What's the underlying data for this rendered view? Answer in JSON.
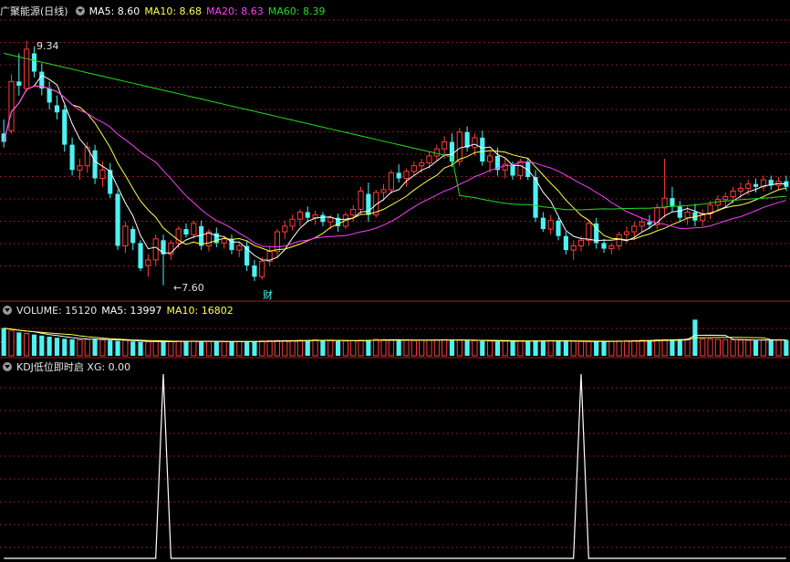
{
  "header": {
    "title": "广聚能源(日线)",
    "ma": [
      {
        "label": "MA5: 8.60",
        "color": "#ffffff"
      },
      {
        "label": "MA10: 8.68",
        "color": "#ffff4a"
      },
      {
        "label": "MA20: 8.63",
        "color": "#ff3dff"
      },
      {
        "label": "MA60: 8.39",
        "color": "#22dd22"
      }
    ]
  },
  "volume_header": {
    "label": "VOLUME: 15120",
    "ma": [
      {
        "label": "MA5: 13997",
        "color": "#ffffff"
      },
      {
        "label": "MA10: 16802",
        "color": "#ffff4a"
      }
    ]
  },
  "kdj_header": {
    "label": "KDJ低位即时启 XG: 0.00"
  },
  "annotations": {
    "high_label": "9.34",
    "low_label": "←7.60",
    "event_marker": "财"
  },
  "colors": {
    "up": "#ff3c3c",
    "down": "#4ef2f2",
    "ma5": "#ffffff",
    "ma10": "#ffff4a",
    "ma20": "#ff3dff",
    "ma60": "#22dd22",
    "grid": "#8b1a1a",
    "frame": "#a01e1e",
    "xg": "#ffffff"
  },
  "chart_data": [
    {
      "type": "candlestick",
      "title": "广聚能源(日线)",
      "ylim": [
        7.5,
        9.5
      ],
      "grid": true,
      "bars": [
        {
          "o": 8.68,
          "h": 8.78,
          "l": 8.58,
          "c": 8.62
        },
        {
          "o": 8.7,
          "h": 9.1,
          "l": 8.68,
          "c": 9.05
        },
        {
          "o": 9.05,
          "h": 9.25,
          "l": 8.95,
          "c": 9.02
        },
        {
          "o": 9.0,
          "h": 9.34,
          "l": 8.98,
          "c": 9.28
        },
        {
          "o": 9.25,
          "h": 9.3,
          "l": 9.08,
          "c": 9.12
        },
        {
          "o": 9.12,
          "h": 9.18,
          "l": 8.95,
          "c": 9.0
        },
        {
          "o": 9.0,
          "h": 9.05,
          "l": 8.85,
          "c": 8.9
        },
        {
          "o": 8.88,
          "h": 8.95,
          "l": 8.78,
          "c": 8.83
        },
        {
          "o": 8.85,
          "h": 8.88,
          "l": 8.55,
          "c": 8.6
        },
        {
          "o": 8.6,
          "h": 8.65,
          "l": 8.38,
          "c": 8.42
        },
        {
          "o": 8.42,
          "h": 8.5,
          "l": 8.35,
          "c": 8.45
        },
        {
          "o": 8.45,
          "h": 8.62,
          "l": 8.4,
          "c": 8.58
        },
        {
          "o": 8.56,
          "h": 8.6,
          "l": 8.32,
          "c": 8.36
        },
        {
          "o": 8.36,
          "h": 8.48,
          "l": 8.3,
          "c": 8.42
        },
        {
          "o": 8.42,
          "h": 8.47,
          "l": 8.22,
          "c": 8.25
        },
        {
          "o": 8.25,
          "h": 8.28,
          "l": 7.85,
          "c": 7.88
        },
        {
          "o": 7.88,
          "h": 8.05,
          "l": 7.83,
          "c": 8.02
        },
        {
          "o": 8.0,
          "h": 8.02,
          "l": 7.85,
          "c": 7.9
        },
        {
          "o": 7.9,
          "h": 7.92,
          "l": 7.7,
          "c": 7.72
        },
        {
          "o": 7.74,
          "h": 7.82,
          "l": 7.66,
          "c": 7.78
        },
        {
          "o": 7.78,
          "h": 7.96,
          "l": 7.74,
          "c": 7.93
        },
        {
          "o": 7.92,
          "h": 7.96,
          "l": 7.6,
          "c": 7.82
        },
        {
          "o": 7.82,
          "h": 7.92,
          "l": 7.78,
          "c": 7.9
        },
        {
          "o": 7.9,
          "h": 8.02,
          "l": 7.86,
          "c": 8.0
        },
        {
          "o": 8.0,
          "h": 8.04,
          "l": 7.94,
          "c": 7.96
        },
        {
          "o": 7.96,
          "h": 8.06,
          "l": 7.93,
          "c": 8.04
        },
        {
          "o": 8.02,
          "h": 8.06,
          "l": 7.85,
          "c": 7.88
        },
        {
          "o": 7.88,
          "h": 8.0,
          "l": 7.84,
          "c": 7.98
        },
        {
          "o": 7.97,
          "h": 8.01,
          "l": 7.87,
          "c": 7.9
        },
        {
          "o": 7.9,
          "h": 7.95,
          "l": 7.86,
          "c": 7.93
        },
        {
          "o": 7.93,
          "h": 7.96,
          "l": 7.82,
          "c": 7.85
        },
        {
          "o": 7.85,
          "h": 7.9,
          "l": 7.8,
          "c": 7.88
        },
        {
          "o": 7.88,
          "h": 7.92,
          "l": 7.7,
          "c": 7.74
        },
        {
          "o": 7.74,
          "h": 7.78,
          "l": 7.63,
          "c": 7.66
        },
        {
          "o": 7.66,
          "h": 7.8,
          "l": 7.64,
          "c": 7.77
        },
        {
          "o": 7.77,
          "h": 7.88,
          "l": 7.74,
          "c": 7.84
        },
        {
          "o": 7.84,
          "h": 8.0,
          "l": 7.8,
          "c": 7.98
        },
        {
          "o": 7.98,
          "h": 8.06,
          "l": 7.93,
          "c": 8.02
        },
        {
          "o": 8.02,
          "h": 8.1,
          "l": 7.99,
          "c": 8.07
        },
        {
          "o": 8.07,
          "h": 8.14,
          "l": 8.02,
          "c": 8.12
        },
        {
          "o": 8.12,
          "h": 8.16,
          "l": 8.05,
          "c": 8.08
        },
        {
          "o": 8.08,
          "h": 8.13,
          "l": 8.03,
          "c": 8.1
        },
        {
          "o": 8.1,
          "h": 8.12,
          "l": 8.02,
          "c": 8.05
        },
        {
          "o": 8.05,
          "h": 8.1,
          "l": 8.0,
          "c": 8.08
        },
        {
          "o": 8.08,
          "h": 8.11,
          "l": 7.98,
          "c": 8.02
        },
        {
          "o": 8.02,
          "h": 8.12,
          "l": 8.0,
          "c": 8.1
        },
        {
          "o": 8.1,
          "h": 8.17,
          "l": 8.05,
          "c": 8.14
        },
        {
          "o": 8.14,
          "h": 8.3,
          "l": 8.1,
          "c": 8.27
        },
        {
          "o": 8.25,
          "h": 8.33,
          "l": 8.05,
          "c": 8.1
        },
        {
          "o": 8.1,
          "h": 8.28,
          "l": 8.08,
          "c": 8.26
        },
        {
          "o": 8.26,
          "h": 8.32,
          "l": 8.2,
          "c": 8.28
        },
        {
          "o": 8.28,
          "h": 8.42,
          "l": 8.25,
          "c": 8.4
        },
        {
          "o": 8.4,
          "h": 8.46,
          "l": 8.33,
          "c": 8.36
        },
        {
          "o": 8.36,
          "h": 8.43,
          "l": 8.3,
          "c": 8.41
        },
        {
          "o": 8.41,
          "h": 8.48,
          "l": 8.38,
          "c": 8.45
        },
        {
          "o": 8.45,
          "h": 8.5,
          "l": 8.4,
          "c": 8.47
        },
        {
          "o": 8.47,
          "h": 8.55,
          "l": 8.43,
          "c": 8.52
        },
        {
          "o": 8.52,
          "h": 8.6,
          "l": 8.48,
          "c": 8.57
        },
        {
          "o": 8.57,
          "h": 8.66,
          "l": 8.5,
          "c": 8.62
        },
        {
          "o": 8.62,
          "h": 8.68,
          "l": 8.44,
          "c": 8.48
        },
        {
          "o": 8.48,
          "h": 8.72,
          "l": 8.45,
          "c": 8.69
        },
        {
          "o": 8.69,
          "h": 8.73,
          "l": 8.55,
          "c": 8.58
        },
        {
          "o": 8.58,
          "h": 8.68,
          "l": 8.52,
          "c": 8.65
        },
        {
          "o": 8.65,
          "h": 8.7,
          "l": 8.45,
          "c": 8.48
        },
        {
          "o": 8.48,
          "h": 8.55,
          "l": 8.4,
          "c": 8.52
        },
        {
          "o": 8.52,
          "h": 8.58,
          "l": 8.38,
          "c": 8.42
        },
        {
          "o": 8.42,
          "h": 8.5,
          "l": 8.36,
          "c": 8.46
        },
        {
          "o": 8.46,
          "h": 8.48,
          "l": 8.35,
          "c": 8.38
        },
        {
          "o": 8.38,
          "h": 8.5,
          "l": 8.35,
          "c": 8.48
        },
        {
          "o": 8.48,
          "h": 8.5,
          "l": 8.35,
          "c": 8.37
        },
        {
          "o": 8.37,
          "h": 8.42,
          "l": 8.05,
          "c": 8.08
        },
        {
          "o": 8.08,
          "h": 8.12,
          "l": 7.98,
          "c": 8.0
        },
        {
          "o": 8.0,
          "h": 8.1,
          "l": 7.96,
          "c": 8.06
        },
        {
          "o": 8.06,
          "h": 8.08,
          "l": 7.92,
          "c": 7.95
        },
        {
          "o": 7.95,
          "h": 7.98,
          "l": 7.82,
          "c": 7.85
        },
        {
          "o": 7.85,
          "h": 7.92,
          "l": 7.78,
          "c": 7.88
        },
        {
          "o": 7.88,
          "h": 7.95,
          "l": 7.84,
          "c": 7.92
        },
        {
          "o": 7.92,
          "h": 8.06,
          "l": 7.88,
          "c": 8.04
        },
        {
          "o": 8.04,
          "h": 8.08,
          "l": 7.86,
          "c": 7.9
        },
        {
          "o": 7.9,
          "h": 7.93,
          "l": 7.83,
          "c": 7.86
        },
        {
          "o": 7.86,
          "h": 7.9,
          "l": 7.82,
          "c": 7.88
        },
        {
          "o": 7.88,
          "h": 7.98,
          "l": 7.85,
          "c": 7.96
        },
        {
          "o": 7.96,
          "h": 8.02,
          "l": 7.9,
          "c": 7.98
        },
        {
          "o": 7.98,
          "h": 8.05,
          "l": 7.92,
          "c": 8.02
        },
        {
          "o": 8.02,
          "h": 8.08,
          "l": 7.98,
          "c": 8.05
        },
        {
          "o": 8.05,
          "h": 8.1,
          "l": 8.0,
          "c": 8.03
        },
        {
          "o": 8.03,
          "h": 8.18,
          "l": 8.0,
          "c": 8.15
        },
        {
          "o": 8.15,
          "h": 8.5,
          "l": 8.08,
          "c": 8.22
        },
        {
          "o": 8.22,
          "h": 8.3,
          "l": 8.12,
          "c": 8.16
        },
        {
          "o": 8.16,
          "h": 8.2,
          "l": 8.05,
          "c": 8.08
        },
        {
          "o": 8.08,
          "h": 8.16,
          "l": 8.03,
          "c": 8.12
        },
        {
          "o": 8.12,
          "h": 8.18,
          "l": 8.02,
          "c": 8.06
        },
        {
          "o": 8.06,
          "h": 8.14,
          "l": 8.02,
          "c": 8.11
        },
        {
          "o": 8.11,
          "h": 8.2,
          "l": 8.07,
          "c": 8.17
        },
        {
          "o": 8.17,
          "h": 8.24,
          "l": 8.12,
          "c": 8.21
        },
        {
          "o": 8.21,
          "h": 8.26,
          "l": 8.15,
          "c": 8.23
        },
        {
          "o": 8.23,
          "h": 8.3,
          "l": 8.18,
          "c": 8.27
        },
        {
          "o": 8.27,
          "h": 8.33,
          "l": 8.22,
          "c": 8.29
        },
        {
          "o": 8.29,
          "h": 8.35,
          "l": 8.24,
          "c": 8.32
        },
        {
          "o": 8.32,
          "h": 8.36,
          "l": 8.26,
          "c": 8.3
        },
        {
          "o": 8.3,
          "h": 8.38,
          "l": 8.27,
          "c": 8.35
        },
        {
          "o": 8.35,
          "h": 8.38,
          "l": 8.28,
          "c": 8.31
        },
        {
          "o": 8.31,
          "h": 8.37,
          "l": 8.28,
          "c": 8.34
        },
        {
          "o": 8.34,
          "h": 8.38,
          "l": 8.27,
          "c": 8.3
        }
      ],
      "ma_lines": [
        "MA5",
        "MA10",
        "MA20",
        "MA60"
      ],
      "annotations": [
        {
          "text": "9.34",
          "bar": 3
        },
        {
          "text": "←7.60",
          "bar": 21
        },
        {
          "text": "财",
          "bar": 34
        }
      ]
    },
    {
      "type": "bar",
      "title": "VOLUME: 15120",
      "note": "volume bars follow candle up/down colouring; MA5 and MA10 overlays",
      "values": [
        26000,
        24000,
        22000,
        21000,
        20000,
        19000,
        18000,
        17000,
        16000,
        15500,
        15000,
        15500,
        16000,
        15000,
        14500,
        14000,
        14500,
        13500,
        13000,
        13200,
        13400,
        13200,
        13600,
        13800,
        14000,
        13700,
        13400,
        13600,
        13500,
        13200,
        13000,
        13400,
        13600,
        13800,
        14000,
        14200,
        14400,
        14300,
        14200,
        14500,
        14800,
        15000,
        14500,
        14300,
        14000,
        13800,
        14200,
        14600,
        15000,
        15500,
        15200,
        15000,
        14800,
        14600,
        14400,
        14600,
        14800,
        15000,
        15200,
        14900,
        14600,
        14400,
        14200,
        14000,
        13800,
        13600,
        13800,
        14000,
        13800,
        13600,
        14600,
        14400,
        14200,
        14000,
        13800,
        13600,
        13400,
        13200,
        13400,
        13600,
        13800,
        14000,
        14200,
        14400,
        14600,
        14800,
        15000,
        15200,
        15400,
        15600,
        15800,
        16000,
        15800,
        15600,
        15400,
        15200,
        15000,
        14800,
        14600,
        14400,
        15120,
        15000,
        14800,
        15000,
        15120
      ],
      "peak_value": 34000,
      "peak_bar": 91
    },
    {
      "type": "line",
      "title": "KDJ低位即时启 XG: 0.00",
      "values_description": "XG signal is 0 except two spikes to 1",
      "spikes_at_bars": [
        21,
        76
      ],
      "ylim": [
        0,
        1
      ]
    }
  ]
}
